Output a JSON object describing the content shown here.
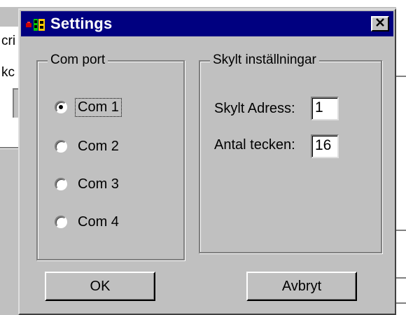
{
  "background": {
    "fragment_top": "cri",
    "fragment_mid": "kc"
  },
  "dialog": {
    "title": "Settings",
    "icon": "app-icon",
    "close_icon": "close-icon",
    "colors": {
      "titlebar": "#000080",
      "face": "#c0c0c0"
    }
  },
  "com_port": {
    "legend": "Com port",
    "options": [
      {
        "label": "Com 1",
        "selected": true
      },
      {
        "label": "Com 2",
        "selected": false
      },
      {
        "label": "Com 3",
        "selected": false
      },
      {
        "label": "Com 4",
        "selected": false
      }
    ]
  },
  "skylt": {
    "legend": "Skylt inställningar",
    "adress_label": "Skylt Adress:",
    "adress_value": "1",
    "antal_label": "Antal tecken:",
    "antal_value": "16"
  },
  "buttons": {
    "ok": "OK",
    "cancel": "Avbryt"
  }
}
